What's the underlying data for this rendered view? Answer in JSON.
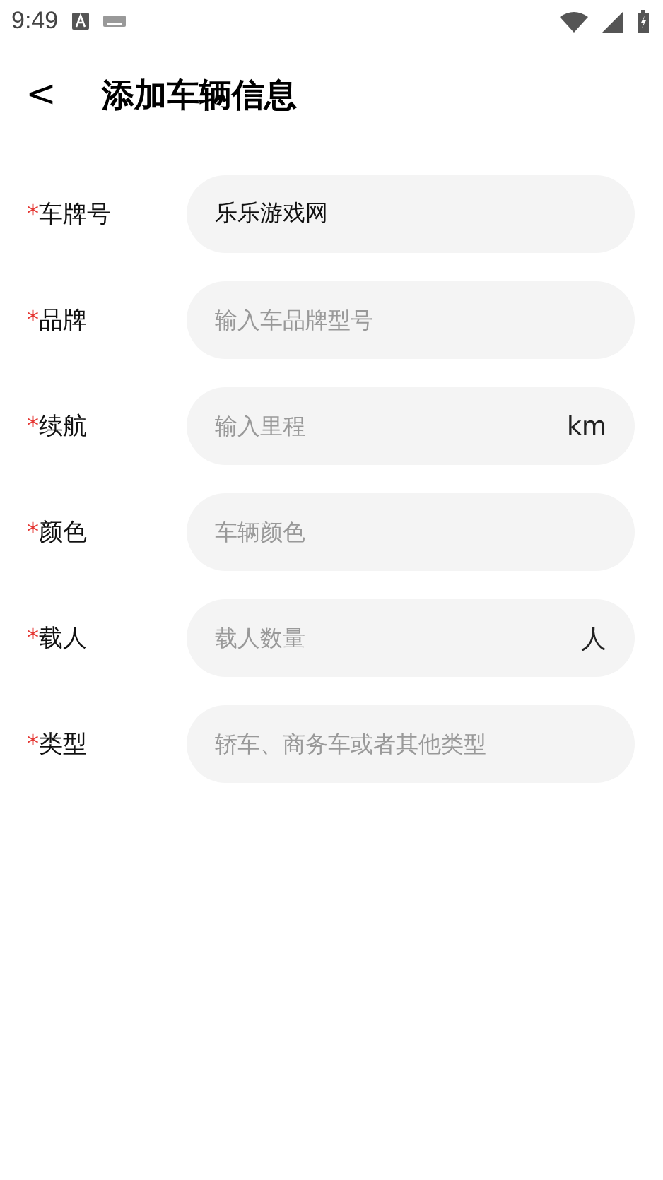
{
  "status_bar": {
    "time": "9:49"
  },
  "header": {
    "back": "<",
    "title": "添加车辆信息"
  },
  "fields": [
    {
      "mark": "*",
      "label": "车牌号",
      "value": "乐乐游戏网"
    },
    {
      "mark": "*",
      "label": "品牌",
      "placeholder": "输入车品牌型号"
    },
    {
      "mark": "*",
      "label": "续航",
      "placeholder": "输入里程",
      "unit": "km"
    },
    {
      "mark": "*",
      "label": "颜色",
      "placeholder": "车辆颜色"
    },
    {
      "mark": "*",
      "label": "载人",
      "placeholder": "载人数量",
      "unit": "人"
    },
    {
      "mark": "*",
      "label": "类型",
      "placeholder": "轿车、商务车或者其他类型"
    }
  ]
}
